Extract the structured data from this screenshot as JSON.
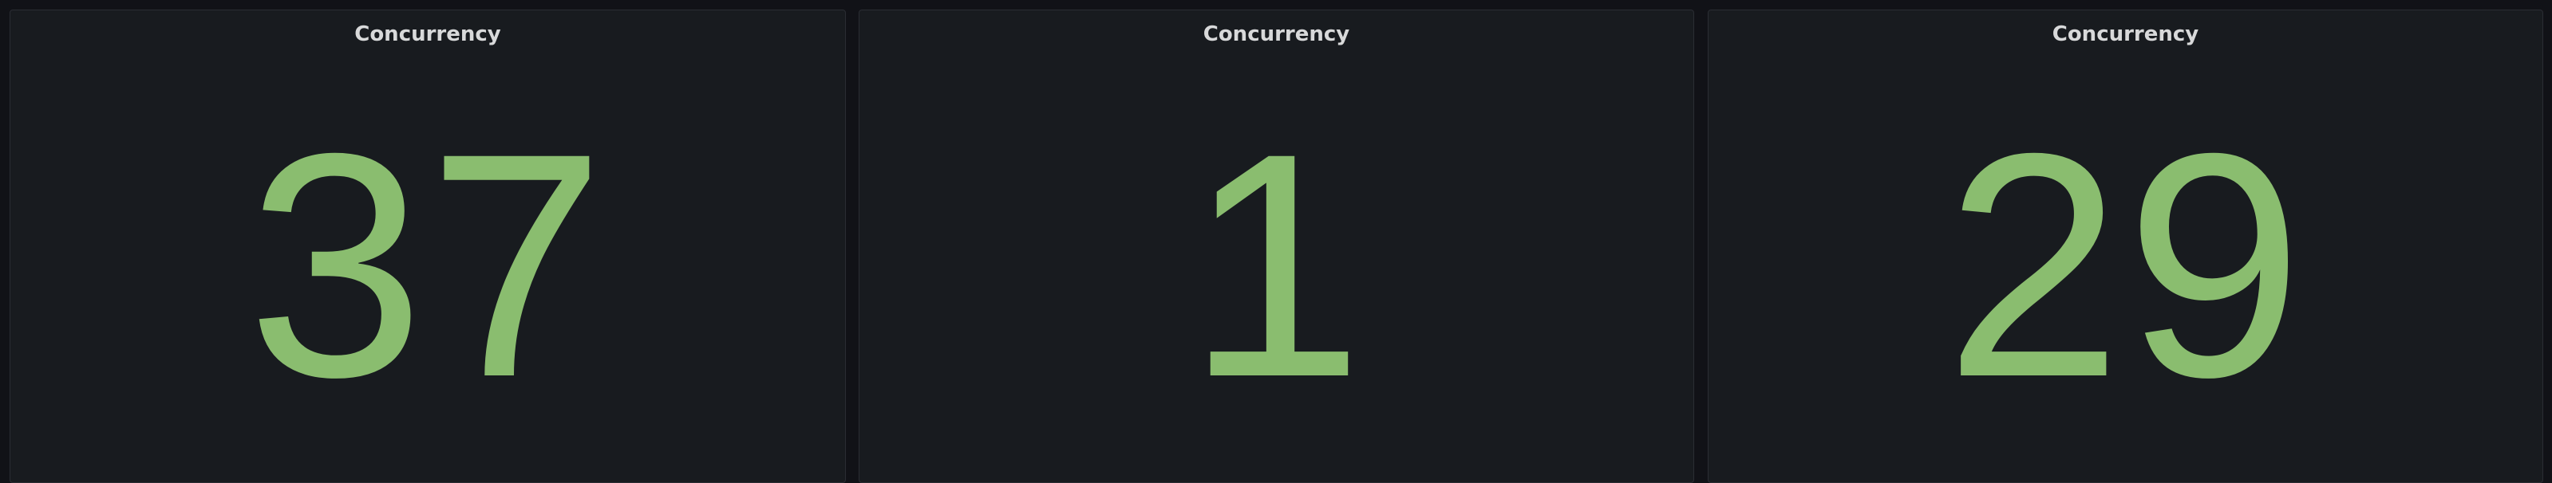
{
  "colors": {
    "background": "#111217",
    "panel_background": "#181b1f",
    "panel_border": "#2a2d33",
    "title_text": "#d8d9da",
    "stat_value": "#8abd6f"
  },
  "panels": [
    {
      "title": "Concurrency",
      "value": "37"
    },
    {
      "title": "Concurrency",
      "value": "1"
    },
    {
      "title": "Concurrency",
      "value": "29"
    }
  ]
}
